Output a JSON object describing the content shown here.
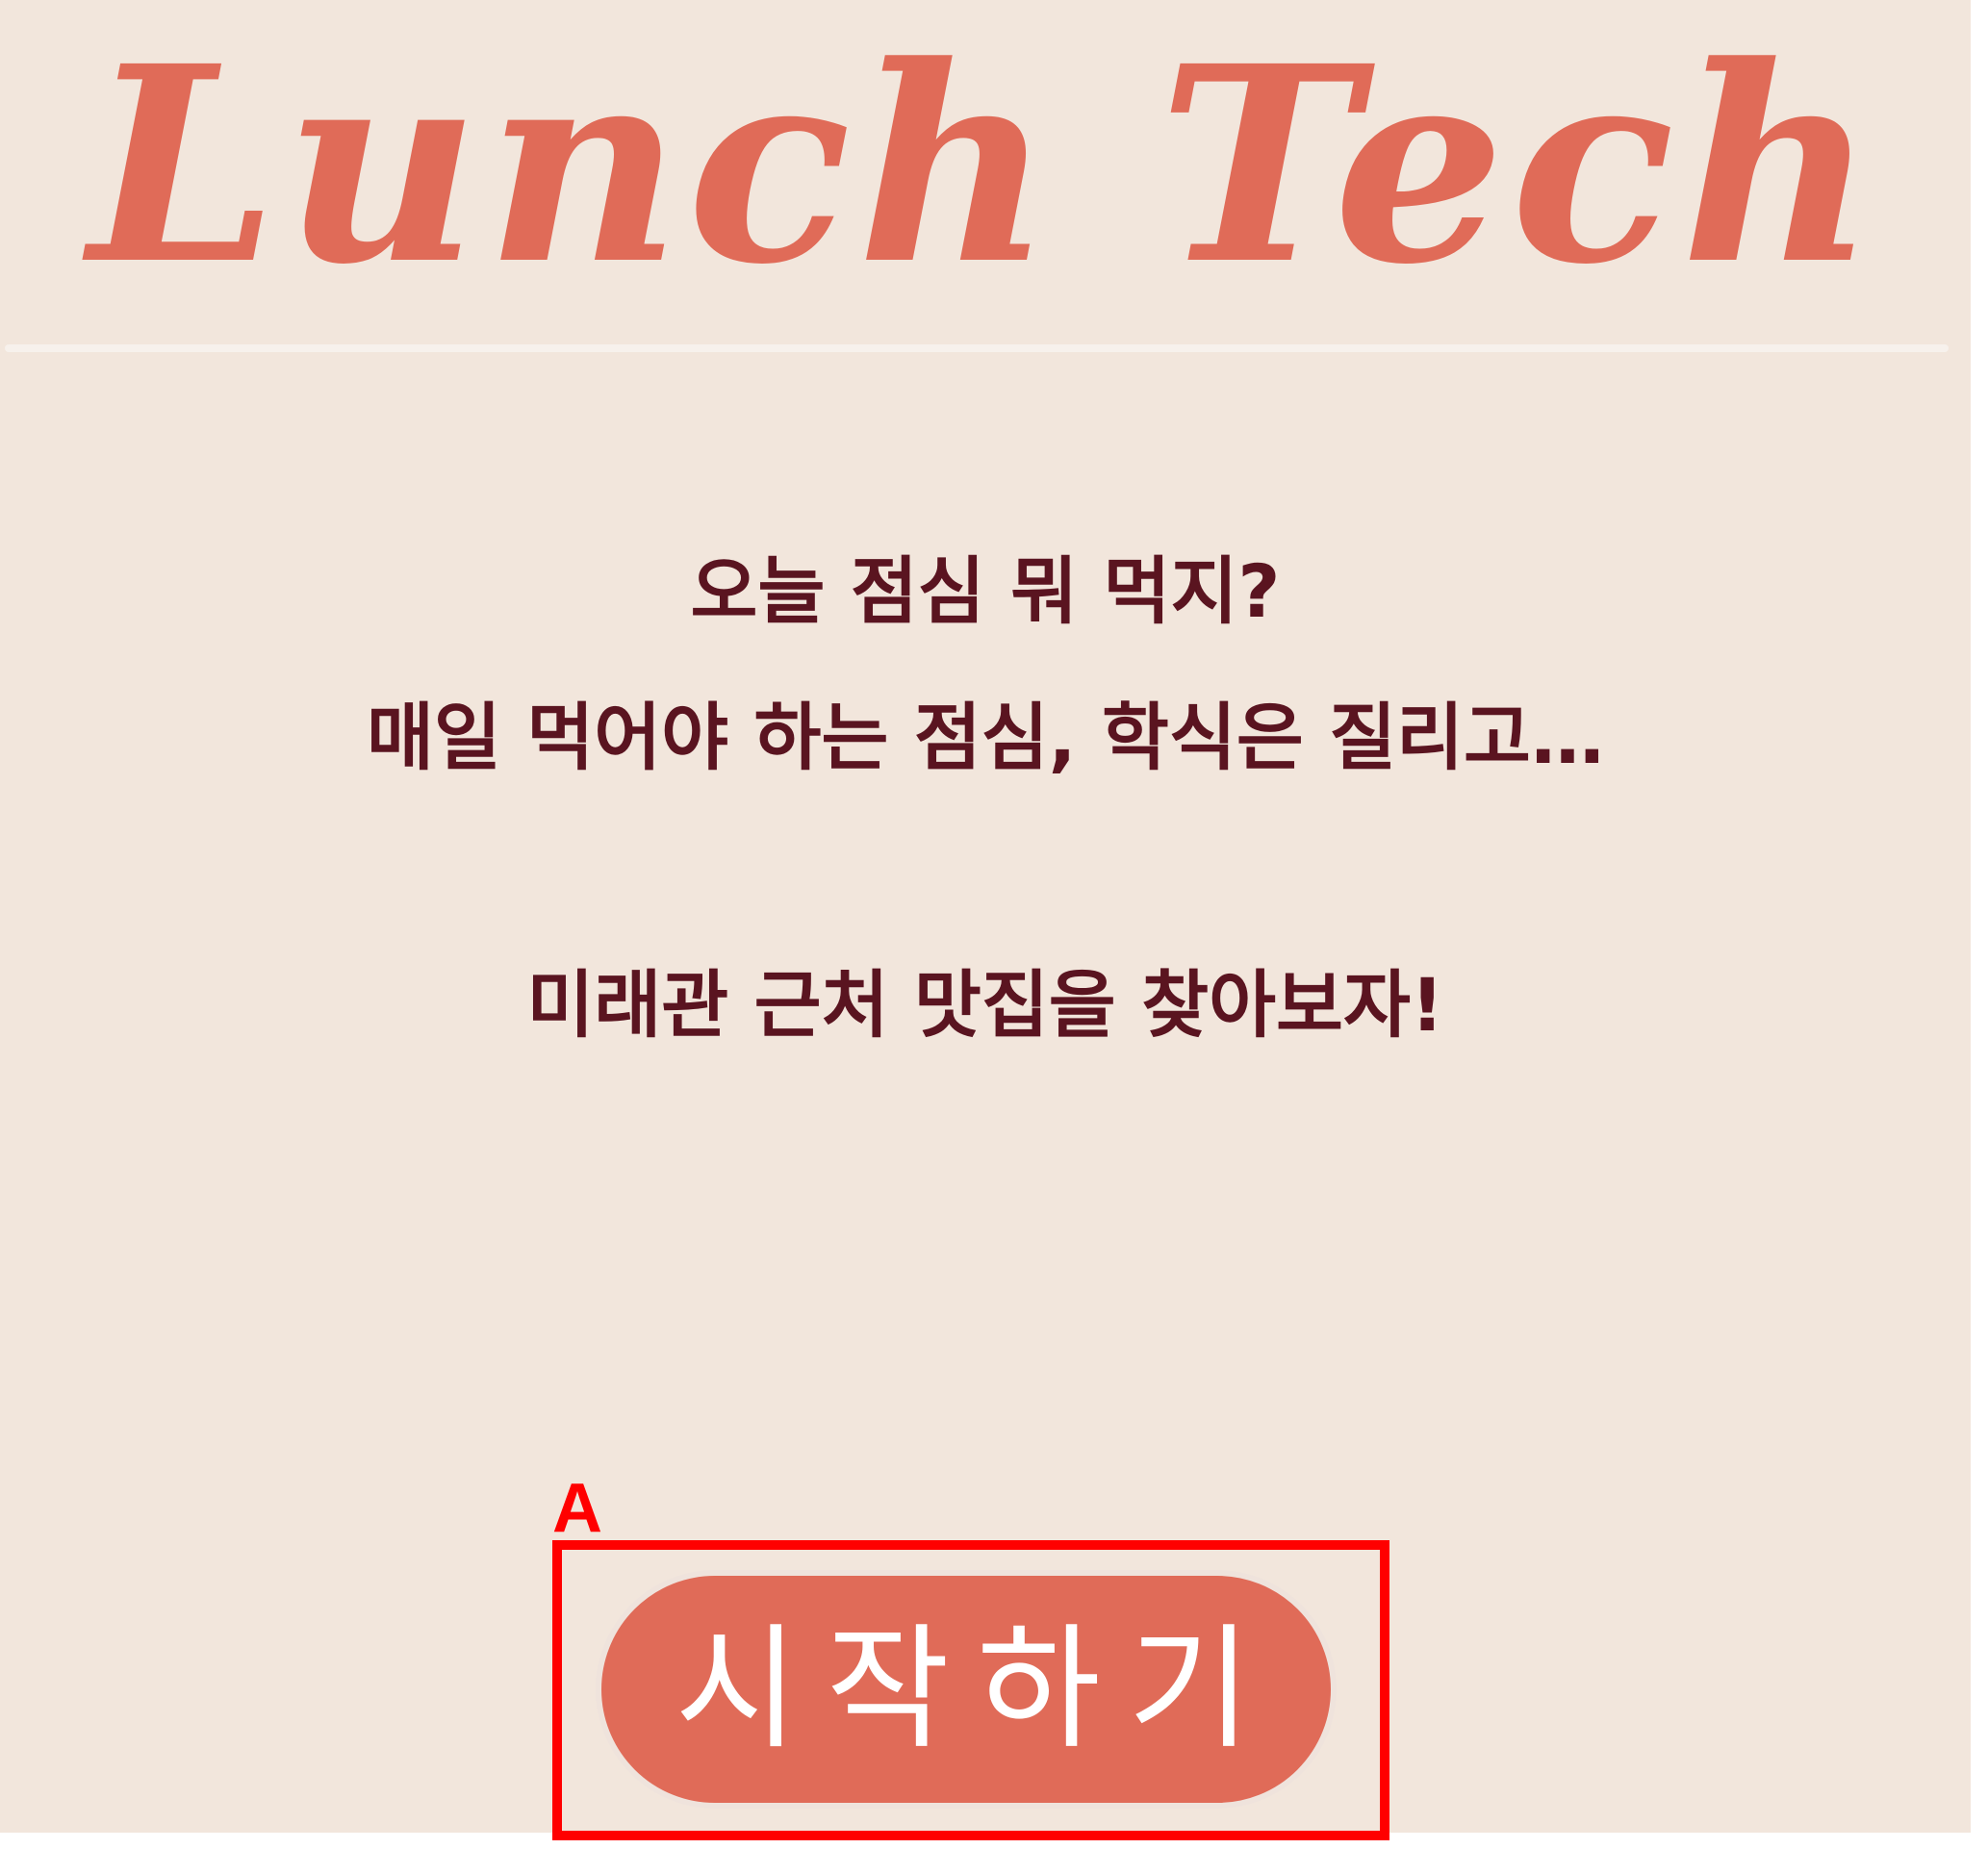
{
  "header": {
    "logo_text": "Lunch Tech"
  },
  "intro": {
    "line1": "오늘 점심 뭐 먹지?",
    "line2": "매일 먹어야 하는 점심, 학식은 질리고…",
    "line3": "미래관 근처 맛집을 찾아보자!"
  },
  "actions": {
    "start_label": "시작하기"
  },
  "annotation": {
    "label": "A"
  },
  "colors": {
    "background": "#f2e6dc",
    "accent": "#e06b58",
    "text": "#5a1420",
    "annotation": "#ff0000"
  }
}
